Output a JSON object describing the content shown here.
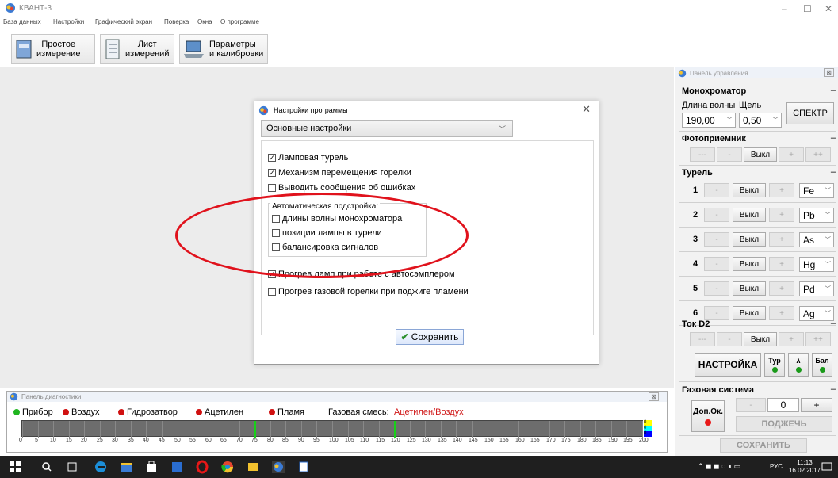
{
  "window": {
    "title": "КВАНТ-3",
    "min": "–",
    "max": "☐",
    "close": "✕"
  },
  "menu": [
    "База данных",
    "Настройки",
    "Графический экран",
    "Поверка",
    "Окна",
    "О программе"
  ],
  "toolbar": [
    {
      "label": "Простое\nизмерение"
    },
    {
      "label": "Лист\nизмерений"
    },
    {
      "label": "Параметры\nи калибровки"
    }
  ],
  "dialog": {
    "title": "Настройки программы",
    "close": "✕",
    "selected": "Основные настройки",
    "options": [
      {
        "label": "Ламповая турель",
        "checked": true
      },
      {
        "label": "Механизм перемещения горелки",
        "checked": true
      },
      {
        "label": "Выводить сообщения об ошибках",
        "checked": false
      }
    ],
    "group_label": "Автоматическая подстройка:",
    "group": [
      {
        "label": "длины волны монохроматора",
        "checked": false
      },
      {
        "label": "позиции лампы в турели",
        "checked": false
      },
      {
        "label": "балансировка сигналов",
        "checked": false
      }
    ],
    "options2": [
      {
        "label": "Прогрев ламп при работе с автосэмплером",
        "checked": true
      },
      {
        "label": "Прогрев газовой горелки при поджиге пламени",
        "checked": false
      }
    ],
    "save": "Сохранить"
  },
  "diag": {
    "title": "Панель диагностики",
    "close": "⊠",
    "indicators": [
      {
        "label": "Прибор",
        "color": "#1fb51f"
      },
      {
        "label": "Воздух",
        "color": "#d01010"
      },
      {
        "label": "Гидрозатвор",
        "color": "#d01010"
      },
      {
        "label": "Ацетилен",
        "color": "#d01010"
      },
      {
        "label": "Пламя",
        "color": "#d01010"
      }
    ],
    "gas_label": "Газовая смесь:",
    "gas_value": "Ацетилен/Воздух",
    "scale": [
      "0",
      "5",
      "10",
      "15",
      "20",
      "25",
      "30",
      "35",
      "40",
      "45",
      "50",
      "55",
      "60",
      "65",
      "70",
      "75",
      "80",
      "85",
      "90",
      "95",
      "100",
      "105",
      "110",
      "115",
      "120",
      "125",
      "130",
      "135",
      "140",
      "145",
      "150",
      "155",
      "160",
      "165",
      "170",
      "175",
      "180",
      "185",
      "190",
      "195",
      "200"
    ],
    "markers": [
      75,
      120
    ],
    "swatch": [
      "#ffff00",
      "#00ffff",
      "#0000ff"
    ],
    "swatch_text": [
      "0",
      "0",
      "0"
    ]
  },
  "panel": {
    "title": "Панель управления",
    "close": "⊠",
    "mono": {
      "title": "Монохроматор",
      "wave_label": "Длина волны",
      "slit_label": "Щель",
      "wave": "190,00",
      "slit": "0,50",
      "spectr": "СПЕКТР"
    },
    "photo": {
      "title": "Фотоприемник",
      "btns": [
        "---",
        "-",
        "Выкл",
        "+",
        "++"
      ]
    },
    "turret": {
      "title": "Турель",
      "rows": [
        {
          "n": "1",
          "el": "Fe"
        },
        {
          "n": "2",
          "el": "Pb"
        },
        {
          "n": "3",
          "el": "As"
        },
        {
          "n": "4",
          "el": "Hg"
        },
        {
          "n": "5",
          "el": "Pd"
        },
        {
          "n": "6",
          "el": "Ag"
        }
      ],
      "off": "Выкл",
      "minus": "-",
      "plus": "+"
    },
    "d2": {
      "title": "Ток D2",
      "btns": [
        "---",
        "-",
        "Выкл",
        "+",
        "++"
      ]
    },
    "setup": {
      "label": "НАСТРОЙКА",
      "toggles": [
        "Тур",
        "λ",
        "Бал"
      ]
    },
    "gas": {
      "title": "Газовая система",
      "dop": "Доп.Ок.",
      "minus": "-",
      "value": "0",
      "plus": "+",
      "ignite": "ПОДЖЕЧЬ"
    },
    "save": "СОХРАНИТЬ",
    "minus": "–"
  },
  "taskbar": {
    "lang": "РУС",
    "time": "11:13",
    "date": "16.02.2017"
  }
}
